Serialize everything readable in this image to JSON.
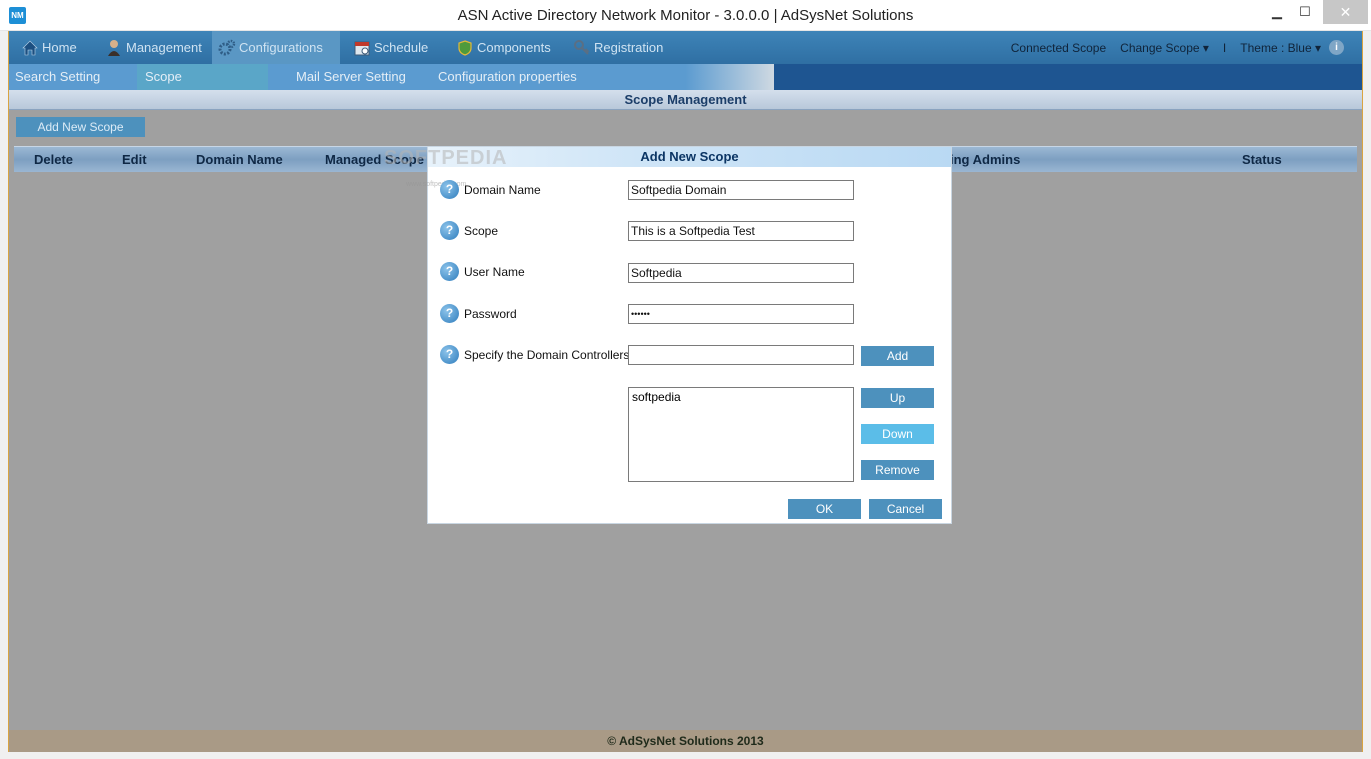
{
  "window": {
    "title": "ASN Active Directory Network Monitor - 3.0.0.0 | AdSysNet Solutions",
    "app_icon_text": "NM",
    "minimize": "▁",
    "maximize": "☐",
    "close": "✕"
  },
  "main_nav": {
    "items": [
      {
        "label": "Home",
        "icon": "home-icon"
      },
      {
        "label": "Management",
        "icon": "user-icon"
      },
      {
        "label": "Configurations",
        "icon": "gears-icon"
      },
      {
        "label": "Schedule",
        "icon": "calendar-icon"
      },
      {
        "label": "Components",
        "icon": "shield-icon"
      },
      {
        "label": "Registration",
        "icon": "key-icon"
      }
    ],
    "active": "Configurations",
    "connected_scope": "Connected Scope",
    "change_scope": "Change Scope ▾",
    "separator": "I",
    "theme": "Theme : Blue ▾",
    "info_icon": "i"
  },
  "sub_nav": {
    "items": [
      "Search Setting",
      "Scope Management",
      "Mail Server Setting",
      "Configuration properties"
    ],
    "active": "Scope Management"
  },
  "section_title": "Scope Management",
  "add_new_scope_button": "Add New Scope",
  "grid": {
    "columns": [
      "Delete",
      "Edit",
      "Domain Name",
      "Managed Scope",
      "ing Admins",
      "Status"
    ]
  },
  "footer": "© AdSysNet Solutions 2013",
  "modal": {
    "title": "Add New Scope",
    "watermark": "SOFTPEDIA",
    "watermark_small": "www.softpedia.com",
    "help_glyph": "?",
    "fields": [
      {
        "label": "Domain Name",
        "value": "Softpedia Domain"
      },
      {
        "label": "Scope",
        "value": "This is a Softpedia Test"
      },
      {
        "label": "User Name",
        "value": "Softpedia"
      },
      {
        "label": "Password",
        "value": "••••••"
      },
      {
        "label": "Specify the Domain Controllers",
        "value": ""
      }
    ],
    "controllers_list": [
      "softpedia"
    ],
    "buttons": {
      "add": "Add",
      "up": "Up",
      "down": "Down",
      "remove": "Remove",
      "ok": "OK",
      "cancel": "Cancel"
    }
  },
  "colors": {
    "nav_blue": "#3e84b8",
    "button_blue": "#4d91bd",
    "button_hover": "#5bbde8",
    "frame_gold": "#d9a441"
  }
}
